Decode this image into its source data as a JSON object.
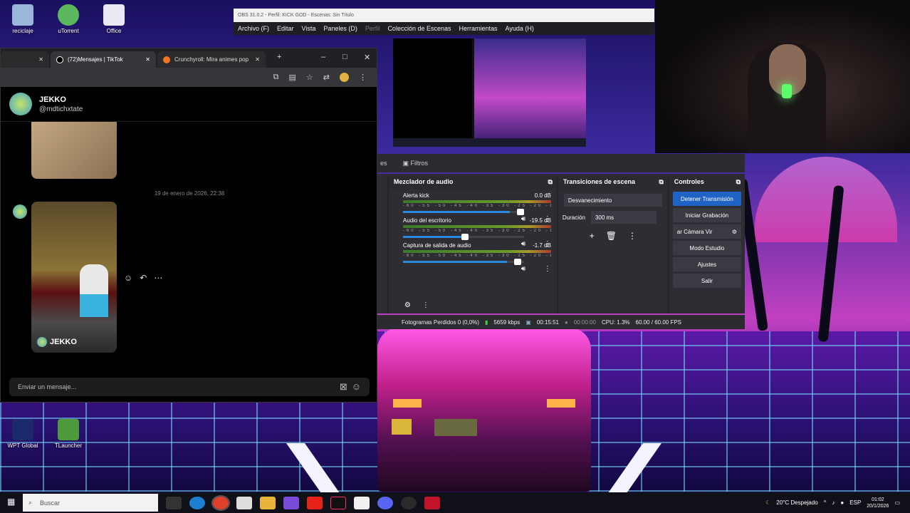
{
  "desktop": {
    "icons": [
      {
        "label": "reciclaje"
      },
      {
        "label": "uTorrent"
      },
      {
        "label": "Office"
      },
      {
        "label": "WPT Global"
      },
      {
        "label": "TLauncher"
      }
    ]
  },
  "chrome": {
    "tabs": [
      {
        "label": "(72)Mensajes | TikTok",
        "icon": "tiktok-icon"
      },
      {
        "label": "Crunchyroll: Mira animes pop",
        "icon": "crunchyroll-icon"
      }
    ],
    "new_tab": "+",
    "minimize": "–",
    "maximize": "□",
    "close": "✕",
    "tab_close": "✕",
    "toolbar_icons": [
      "screenshot-icon",
      "translate-icon",
      "star-icon",
      "extension-icon",
      "profile-icon",
      "menu-icon"
    ]
  },
  "tiktok": {
    "chat_name": "JEKKO",
    "chat_handle": "@mdtichxtate",
    "date_separator": "19 de enero de 2026, 22:38",
    "media_caption": "JEKKO",
    "composer_placeholder": "Enviar un mensaje...",
    "actions": [
      "☺",
      "↶",
      "⋯"
    ]
  },
  "obs": {
    "title": "OBS 31.0.2 - Perfil: KICK GOD - Escenas: Sin Título",
    "menu": [
      {
        "label": "Archivo (F)",
        "disabled": false
      },
      {
        "label": "Editar",
        "disabled": false
      },
      {
        "label": "Vista",
        "disabled": false
      },
      {
        "label": "Paneles (D)",
        "disabled": false
      },
      {
        "label": "Perfil",
        "disabled": true
      },
      {
        "label": "Colección de Escenas",
        "disabled": false
      },
      {
        "label": "Herramientas",
        "disabled": false
      },
      {
        "label": "Ayuda (H)",
        "disabled": false
      }
    ],
    "filters_tab": "Filtros",
    "filters_left": "es",
    "mixer": {
      "title": "Mezclador de audio",
      "channels": [
        {
          "name": "Alerta kick",
          "db": "0.0 dB",
          "vol": 0.88
        },
        {
          "name": "Audio del escritorio",
          "db": "-19.5 dB",
          "vol": 0.52
        },
        {
          "name": "Captura de salida de audio",
          "db": "-1.7 dB",
          "vol": 0.86
        }
      ],
      "ticks": "-60 -55 -50 -45 -40 -35 -30 -25 -20 -15 -10 -5 0"
    },
    "transitions": {
      "title": "Transiciones de escena",
      "type": "Desvanecimiento",
      "duration_label": "Duración",
      "duration": "300 ms"
    },
    "controls": {
      "title": "Controles",
      "stop": "Detener Transmisión",
      "record": "Iniciar Grabación",
      "vcam": "ar Cámara Vir",
      "studio": "Modo Estudio",
      "settings": "Ajustes",
      "exit": "Salir"
    },
    "status": {
      "dropped": "Fotogramas Perdidos 0 (0,0%)",
      "kbps": "5659 kbps",
      "stream_time": "00:15:51",
      "rec_time": "00:00:00",
      "cpu": "CPU: 1.3%",
      "fps": "60.00 / 60.00 FPS"
    }
  },
  "taskbar": {
    "search": "Buscar",
    "weather": "20°C  Despejado",
    "lang": "ESP",
    "time": "01:02",
    "date": "20/1/2026"
  },
  "colors": {
    "obs_blue": "#2063c6",
    "accent": "#ff3ea8"
  }
}
